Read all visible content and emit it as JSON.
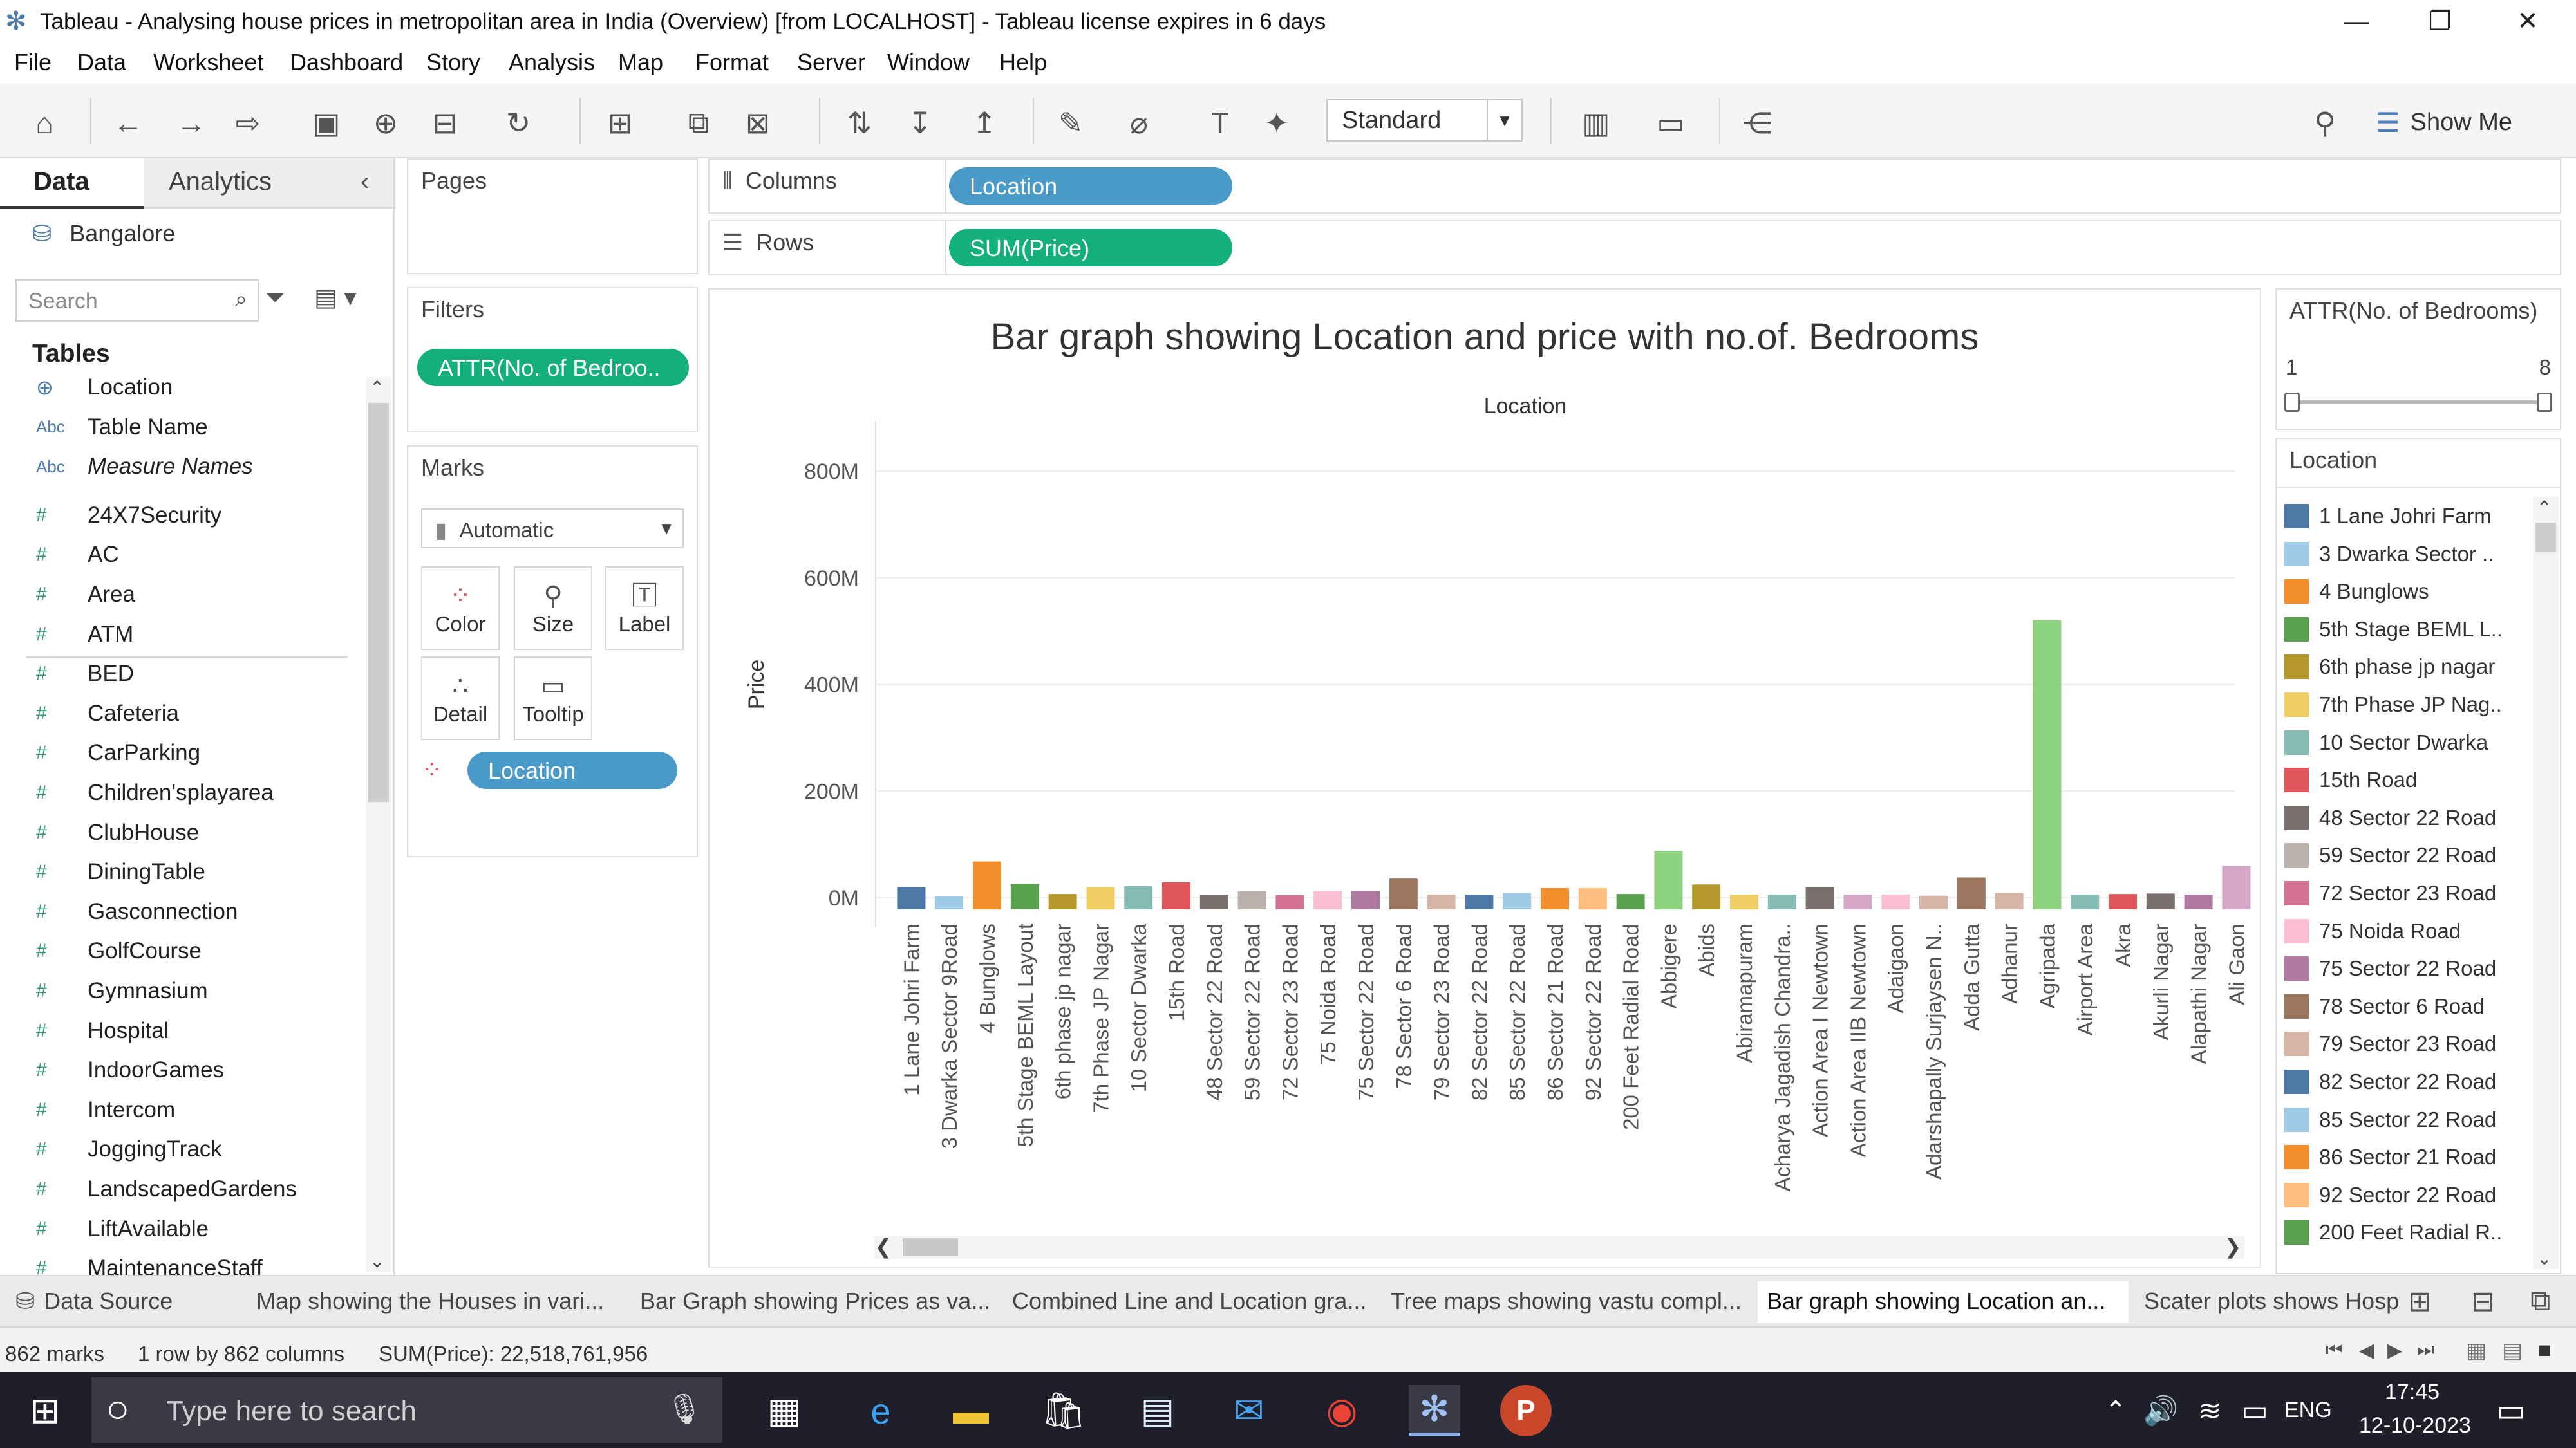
{
  "window": {
    "title": "Tableau - Analysing house prices in metropolitan area in India (Overview) [from LOCALHOST] - Tableau license expires in 6 days"
  },
  "menu": [
    "File",
    "Data",
    "Worksheet",
    "Dashboard",
    "Story",
    "Analysis",
    "Map",
    "Format",
    "Server",
    "Window",
    "Help"
  ],
  "toolbar": {
    "fit_dropdown": "Standard",
    "show_me": "Show Me"
  },
  "sidebar": {
    "tab_data": "Data",
    "tab_analytics": "Analytics",
    "datasource": "Bangalore",
    "search_placeholder": "Search",
    "tables_heading": "Tables",
    "fields": [
      {
        "icon": "globe",
        "name": "Location"
      },
      {
        "icon": "Abc",
        "name": "Table Name"
      },
      {
        "icon": "Abc",
        "name": "Measure Names"
      },
      {
        "icon": "#",
        "name": "24X7Security"
      },
      {
        "icon": "#",
        "name": "AC"
      },
      {
        "icon": "#",
        "name": "Area"
      },
      {
        "icon": "#",
        "name": "ATM"
      },
      {
        "icon": "#",
        "name": "BED"
      },
      {
        "icon": "#",
        "name": "Cafeteria"
      },
      {
        "icon": "#",
        "name": "CarParking"
      },
      {
        "icon": "#",
        "name": "Children'splayarea"
      },
      {
        "icon": "#",
        "name": "ClubHouse"
      },
      {
        "icon": "#",
        "name": "DiningTable"
      },
      {
        "icon": "#",
        "name": "Gasconnection"
      },
      {
        "icon": "#",
        "name": "GolfCourse"
      },
      {
        "icon": "#",
        "name": "Gymnasium"
      },
      {
        "icon": "#",
        "name": "Hospital"
      },
      {
        "icon": "#",
        "name": "IndoorGames"
      },
      {
        "icon": "#",
        "name": "Intercom"
      },
      {
        "icon": "#",
        "name": "JoggingTrack"
      },
      {
        "icon": "#",
        "name": "LandscapedGardens"
      },
      {
        "icon": "#",
        "name": "LiftAvailable"
      },
      {
        "icon": "#",
        "name": "MaintenanceStaff"
      }
    ]
  },
  "cards": {
    "pages": "Pages",
    "filters": "Filters",
    "filter_pill": "ATTR(No. of Bedroo..",
    "marks": "Marks",
    "mark_type": "Automatic",
    "mark_buttons": [
      "Color",
      "Size",
      "Label",
      "Detail",
      "Tooltip"
    ],
    "marks_pill": "Location"
  },
  "shelves": {
    "columns_label": "Columns",
    "columns_pill": "Location",
    "rows_label": "Rows",
    "rows_pill": "SUM(Price)"
  },
  "chart_data": {
    "type": "bar",
    "title": "Bar graph showing Location and price with no.of. Bedrooms",
    "xlabel": "Location",
    "ylabel": "Price",
    "ylim": [
      -10,
      800
    ],
    "yticks": [
      "0M",
      "200M",
      "400M",
      "600M",
      "800M"
    ],
    "ytick_values": [
      0,
      200,
      400,
      600,
      800
    ],
    "categories": [
      "1 Lane Johri Farm",
      "3 Dwarka Sector 9Road",
      "4 Bunglows",
      "5th Stage BEML Layout",
      "6th phase jp nagar",
      "7th Phase JP Nagar",
      "10 Sector Dwarka",
      "15th Road",
      "48 Sector 22 Road",
      "59 Sector 22 Road",
      "72 Sector 23 Road",
      "75 Noida Road",
      "75 Sector 22 Road",
      "78 Sector 6 Road",
      "79 Sector 23 Road",
      "82 Sector 22 Road",
      "85 Sector 22 Road",
      "86 Sector 21 Road",
      "92 Sector 22 Road",
      "200 Feet Radial Road",
      "Abbigere",
      "Abids",
      "Abiramapuram",
      "Acharya Jagadish Chandra..",
      "Action Area I Newtown",
      "Action Area IIB Newtown",
      "Adaigaon",
      "Adarshapally Surjaysen N..",
      "Adda Gutta",
      "Adhanur",
      "Agripada",
      "Airport Area",
      "Akra",
      "Akurli Nagar",
      "Alapathi Nagar",
      "Ali Gaon",
      ""
    ],
    "values": [
      20,
      3,
      68,
      26,
      7,
      20,
      22,
      29,
      6,
      13,
      5,
      13,
      13,
      36,
      6,
      6,
      9,
      18,
      18,
      7,
      88,
      25,
      6,
      6,
      20,
      6,
      6,
      4,
      38,
      9,
      520,
      6,
      7,
      8,
      6,
      60,
      7
    ],
    "colors": [
      "#4e79a7",
      "#a0cbe8",
      "#f28e2b",
      "#59a14f",
      "#b6992d",
      "#f1ce63",
      "#86bcb6",
      "#e15759",
      "#79706e",
      "#bab0ac",
      "#d37295",
      "#fabfd2",
      "#b07aa1",
      "#9d7660",
      "#d7b5a6",
      "#4e79a7",
      "#a0cbe8",
      "#f28e2b",
      "#ffbe7d",
      "#59a14f",
      "#8cd17d",
      "#b6992d",
      "#f1ce63",
      "#86bcb6",
      "#79706e",
      "#d4a6c8",
      "#fabfd2",
      "#d7b5a6",
      "#9d7660",
      "#d7b5a6",
      "#8cd17d",
      "#86bcb6",
      "#e15759",
      "#79706e",
      "#b07aa1",
      "#d4a6c8",
      "#e15759"
    ]
  },
  "bedroom_filter": {
    "title": "ATTR(No. of Bedrooms)",
    "min": "1",
    "max": "8"
  },
  "legend": {
    "title": "Location",
    "items": [
      {
        "label": "1 Lane Johri Farm",
        "color": "#4e79a7"
      },
      {
        "label": "3 Dwarka Sector ..",
        "color": "#a0cbe8"
      },
      {
        "label": "4 Bunglows",
        "color": "#f28e2b"
      },
      {
        "label": "5th Stage BEML L..",
        "color": "#59a14f"
      },
      {
        "label": "6th phase jp nagar",
        "color": "#b6992d"
      },
      {
        "label": "7th Phase JP Nag..",
        "color": "#f1ce63"
      },
      {
        "label": "10 Sector Dwarka",
        "color": "#86bcb6"
      },
      {
        "label": "15th Road",
        "color": "#e15759"
      },
      {
        "label": "48 Sector 22 Road",
        "color": "#79706e"
      },
      {
        "label": "59 Sector 22 Road",
        "color": "#bab0ac"
      },
      {
        "label": "72 Sector 23 Road",
        "color": "#d37295"
      },
      {
        "label": "75 Noida Road",
        "color": "#fabfd2"
      },
      {
        "label": "75 Sector 22 Road",
        "color": "#b07aa1"
      },
      {
        "label": "78 Sector 6 Road",
        "color": "#9d7660"
      },
      {
        "label": "79 Sector 23 Road",
        "color": "#d7b5a6"
      },
      {
        "label": "82 Sector 22 Road",
        "color": "#4e79a7"
      },
      {
        "label": "85 Sector 22 Road",
        "color": "#a0cbe8"
      },
      {
        "label": "86 Sector 21 Road",
        "color": "#f28e2b"
      },
      {
        "label": "92 Sector 22 Road",
        "color": "#ffbe7d"
      },
      {
        "label": "200 Feet Radial R..",
        "color": "#59a14f"
      }
    ]
  },
  "sheet_tabs": [
    "Data Source",
    "Map showing the Houses in vari...",
    "Bar Graph showing Prices as va...",
    "Combined Line and Location gra...",
    "Tree maps showing vastu compl...",
    "Bar graph showing Location an...",
    "Scater plots shows Hosp"
  ],
  "status": {
    "marks": "862 marks",
    "dims": "1 row by 862 columns",
    "sum": "SUM(Price): 22,518,761,956"
  },
  "taskbar": {
    "search_placeholder": "Type here to search",
    "lang": "ENG",
    "time": "17:45",
    "date": "12-10-2023"
  }
}
